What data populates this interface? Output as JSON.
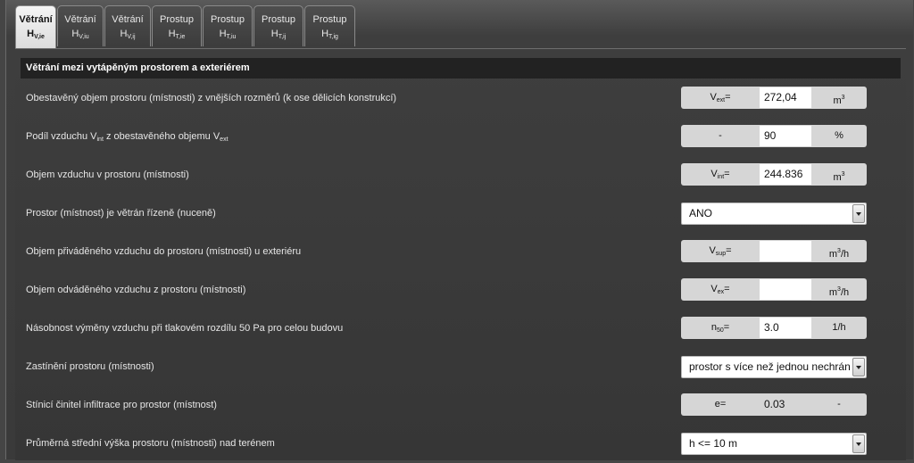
{
  "tabs": [
    {
      "line1": "Větrání",
      "main": "H",
      "sub": "V,ie",
      "active": true
    },
    {
      "line1": "Větrání",
      "main": "H",
      "sub": "V,iu",
      "active": false
    },
    {
      "line1": "Větrání",
      "main": "H",
      "sub": "V,ij",
      "active": false
    },
    {
      "line1": "Prostup",
      "main": "H",
      "sub": "T,ie",
      "active": false
    },
    {
      "line1": "Prostup",
      "main": "H",
      "sub": "T,iu",
      "active": false
    },
    {
      "line1": "Prostup",
      "main": "H",
      "sub": "T,ij",
      "active": false
    },
    {
      "line1": "Prostup",
      "main": "H",
      "sub": "T,ig",
      "active": false
    }
  ],
  "section_title": "Větrání mezi vytápěným prostorem a exteriérem",
  "rows": {
    "r1": {
      "label": "Obestavěný objem prostoru (místnosti) z vnějších rozměrů (k ose dělicích konstrukcí)",
      "sym": "V",
      "sym_sub": "ext",
      "sym_tail": "=",
      "value": "272,04",
      "unit": "m",
      "unit_sup": "3",
      "unit_tail": ""
    },
    "r2": {
      "label_a": "Podíl vzduchu V",
      "label_a_sub": "int",
      "label_b": " z obestavěného objemu V",
      "label_b_sub": "ext",
      "sym": "-",
      "value": "90",
      "unit": "%"
    },
    "r3": {
      "label": "Objem vzduchu v prostoru (místnosti)",
      "sym": "V",
      "sym_sub": "int",
      "sym_tail": "=",
      "value": "244.836",
      "unit": "m",
      "unit_sup": "3",
      "unit_tail": ""
    },
    "r4": {
      "label": "Prostor (místnost) je větrán řízeně (nuceně)",
      "selected": "ANO"
    },
    "r5": {
      "label": "Objem přiváděného vzduchu do prostoru (místnosti) u exteriéru",
      "sym": "V",
      "sym_sub": "sup",
      "sym_tail": "=",
      "value": "",
      "unit": "m",
      "unit_sup": "3",
      "unit_tail": "/h"
    },
    "r6": {
      "label": "Objem odváděného vzduchu z prostoru (místnosti)",
      "sym": "V",
      "sym_sub": "ex",
      "sym_tail": "=",
      "value": "",
      "unit": "m",
      "unit_sup": "3",
      "unit_tail": "/h"
    },
    "r7": {
      "label": "Násobnost výměny vzduchu při tlakovém rozdílu 50 Pa pro celou budovu",
      "sym": "n",
      "sym_sub": "50",
      "sym_tail": "=",
      "value": "3.0",
      "unit": "1/h"
    },
    "r8": {
      "label": "Zastínění prostoru (místnosti)",
      "selected": "prostor s více než jednou nechráněnou"
    },
    "r9": {
      "label": "Stínicí činitel infiltrace pro prostor (místnost)",
      "sym": "e=",
      "value": "0.03",
      "unit": "-"
    },
    "r10": {
      "label": "Průměrná střední výška prostoru (místnosti) nad terénem",
      "selected": "h <= 10 m"
    }
  },
  "icons": {
    "dropdown": "chevron-down-icon"
  },
  "colors": {
    "background": "#3a3a3a",
    "header_bar": "#222222",
    "active_tab": "#e8e8e8",
    "field_bg": "#d6d6d6"
  }
}
